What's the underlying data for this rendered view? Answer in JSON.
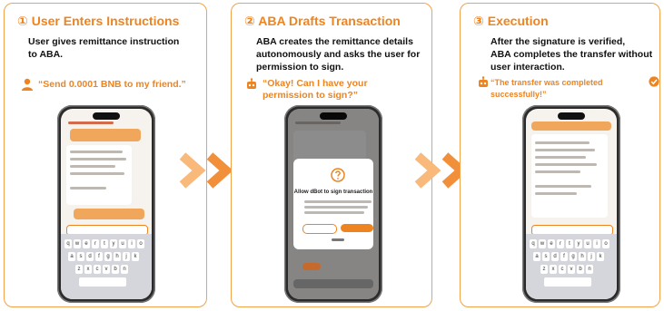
{
  "colors": {
    "accent": "#ee8420",
    "arrow_light": "#f8b97a",
    "arrow_mid": "#f28f3b",
    "arrow_dark": "#e8541e"
  },
  "panels": [
    {
      "number": "①",
      "title": "User Enters Instructions",
      "body": "User gives remittance instruction\nto ABA.",
      "quote_icon": "person-icon",
      "quote": "“Send 0.0001 BNB to my friend.”"
    },
    {
      "number": "②",
      "title": "ABA Drafts Transaction",
      "body": "ABA creates the remittance details\nautonomously and asks the user for\npermission to sign.",
      "quote_icon": "robot-icon",
      "quote": "“Okay! Can I have your\npermission to sign?”"
    },
    {
      "number": "③",
      "title": "Execution",
      "body": "After the signature is verified,\nABA completes the transfer without\nuser interaction.",
      "quote_icon": "robot-icon",
      "quote": "“The transfer was completed successfully!”"
    }
  ],
  "phone2_dialog": {
    "title": "Allow dBot to sign transaction"
  }
}
